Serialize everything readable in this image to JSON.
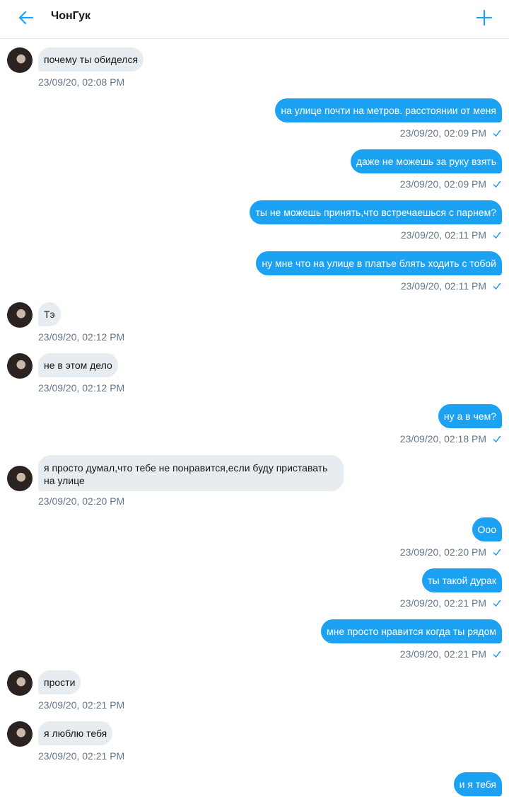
{
  "header": {
    "title": "ЧонГук",
    "back_icon": "arrow-left-icon",
    "add_icon": "plus-icon",
    "accent_color": "#1da1f2"
  },
  "colors": {
    "incoming_bubble": "#e6ecf0",
    "outgoing_bubble": "#1da1f2",
    "timestamp": "#657786"
  },
  "messages": [
    {
      "dir": "in",
      "text": "почему ты обиделся",
      "time": "23/09/20, 02:08 PM"
    },
    {
      "dir": "out",
      "text": "на улице почти на метров. расстоянии от меня",
      "time": "23/09/20, 02:09 PM",
      "read": "check-icon"
    },
    {
      "dir": "out",
      "text": "даже не можешь за руку взять",
      "time": "23/09/20, 02:09 PM",
      "read": "check-icon"
    },
    {
      "dir": "out",
      "text": "ты не можешь принять,что встречаешься с парнем?",
      "time": "23/09/20, 02:11 PM",
      "read": "check-icon"
    },
    {
      "dir": "out",
      "text": "ну мне что на улице в платье блять ходить с тобой",
      "time": "23/09/20, 02:11 PM",
      "read": "check-icon"
    },
    {
      "dir": "in",
      "text": "Тэ",
      "time": "23/09/20, 02:12 PM"
    },
    {
      "dir": "in",
      "text": "не в этом дело",
      "time": "23/09/20, 02:12 PM"
    },
    {
      "dir": "out",
      "text": "ну а в чем?",
      "time": "23/09/20, 02:18 PM",
      "read": "check-icon"
    },
    {
      "dir": "in",
      "text": "я просто думал,что тебе не понравится,если буду приставать на улице",
      "time": "23/09/20, 02:20 PM"
    },
    {
      "dir": "out",
      "text": "Ооо",
      "time": "23/09/20, 02:20 PM",
      "read": "check-icon"
    },
    {
      "dir": "out",
      "text": "ты такой дурак",
      "time": "23/09/20, 02:21 PM",
      "read": "check-icon"
    },
    {
      "dir": "out",
      "text": "мне просто нравится когда ты рядом",
      "time": "23/09/20, 02:21 PM",
      "read": "check-icon"
    },
    {
      "dir": "in",
      "text": "прости",
      "time": "23/09/20, 02:21 PM"
    },
    {
      "dir": "in",
      "text": "я люблю тебя",
      "time": "23/09/20, 02:21 PM"
    },
    {
      "dir": "out",
      "text": "и я тебя",
      "time": ""
    }
  ]
}
